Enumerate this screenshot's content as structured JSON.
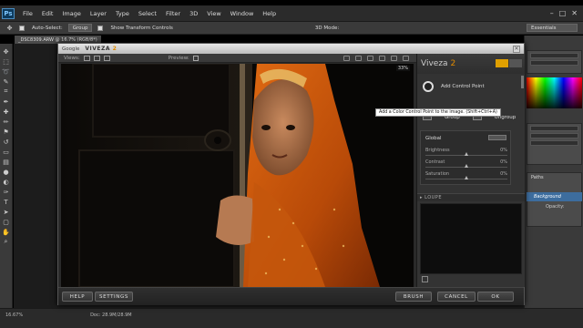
{
  "menubar": {
    "logo": "Ps",
    "items": [
      "File",
      "Edit",
      "Image",
      "Layer",
      "Type",
      "Select",
      "Filter",
      "3D",
      "View",
      "Window",
      "Help"
    ],
    "window_controls": [
      "–",
      "□",
      "✕"
    ]
  },
  "optionsbar": {
    "auto_select": "Auto-Select:",
    "group": "Group",
    "show_transform": "Show Transform Controls",
    "mode": "3D Mode:",
    "workspace": "Essentials"
  },
  "doc_tab": "_DSC8309.ARW @ 16.7% (RGB/8*)",
  "right_panels": {
    "layers_tab": "Paths",
    "opacity": "Opacity:",
    "layer_name": "Background"
  },
  "status": {
    "zoom": "16.67%",
    "doc": "Doc: 28.9M/28.9M"
  },
  "viveza": {
    "google": "Google",
    "name": "VIVEZA",
    "name_num": "2",
    "views_label": "Views:",
    "preview_label": "Preview:",
    "zoom": "33%",
    "panel_title": "Viveza",
    "panel_title_num": "2",
    "add_control_point": "Add Control Point",
    "tooltip": "Add a Color Control Point to the image. (Shift+Ctrl+A)",
    "group": "Group",
    "ungroup": "Ungroup",
    "global": "Global",
    "sliders": [
      {
        "label": "Brightness",
        "value": "0%",
        "level": 0.5
      },
      {
        "label": "Contrast",
        "value": "0%",
        "level": 0.5
      },
      {
        "label": "Saturation",
        "value": "0%",
        "level": 0.5
      }
    ],
    "loupe": "▸ LOUPE",
    "buttons": {
      "help": "HELP",
      "settings": "SETTINGS",
      "brush": "BRUSH",
      "cancel": "CANCEL",
      "ok": "OK"
    }
  }
}
